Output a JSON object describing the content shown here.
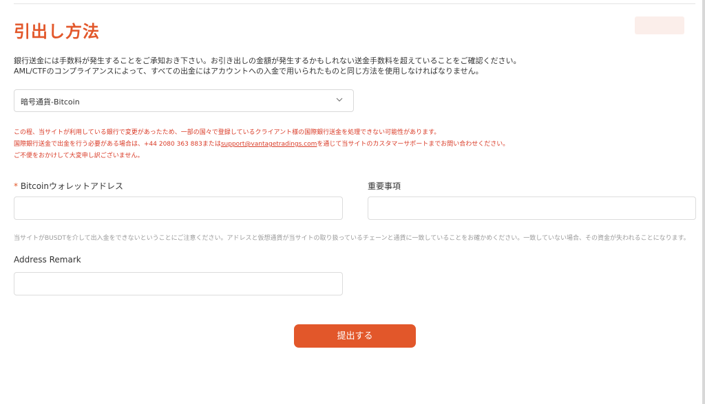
{
  "page": {
    "title": "引出し方法"
  },
  "info": {
    "line1": "銀行送金には手数料が発生することをご承知おき下さい。お引き出しの金額が発生するかもしれない送金手数料を超えていることをご確認ください。",
    "line2": "AML/CTFのコンプライアンスによって、すべての出金にはアカウントへの入金で用いられたものと同じ方法を使用しなければなりません。"
  },
  "method_select": {
    "value": "暗号通貨-Bitcoin"
  },
  "warning": {
    "line1": "この程、当サイトが利用している銀行で変更があったため、一部の国々で登録しているクライアント様の国際銀行送金を処理できない可能性があります。",
    "line2_before": "国際銀行送金で出金を行う必要がある場合は、+44 2080 363 883または",
    "line2_link": "support@vantagetradings.com",
    "line2_after": "を通じて当サイトのカスタマーサポートまでお問い合わせください。",
    "line3": "ご不便をおかけして大変申し訳ございません。"
  },
  "form": {
    "wallet_label_required": "*",
    "wallet_label": "Bitcoinウォレットアドレス",
    "wallet_value": "",
    "important_label": "重要事項",
    "important_value": "",
    "hint": "当サイトがBUSDTを介して出入金をできないということにご注意ください。アドレスと仮想通貨が当サイトの取り扱っているチェーンと通貨に一致していることをお確かめください。一致していない場合、その資金が失われることになります。",
    "remark_label": "Address Remark",
    "remark_value": ""
  },
  "submit": {
    "label": "提出する"
  },
  "colors": {
    "accent": "#e2572a",
    "warning": "#d93a26"
  }
}
